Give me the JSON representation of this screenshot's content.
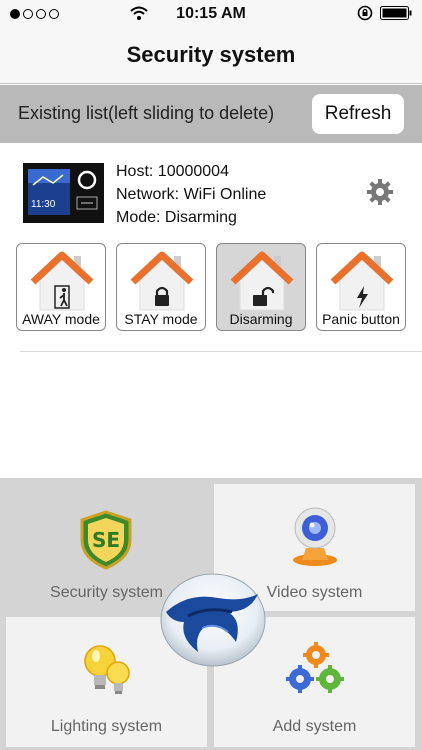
{
  "status_bar": {
    "time": "10:15 AM"
  },
  "nav": {
    "title": "Security system"
  },
  "list_header": {
    "hint": "Existing list(left sliding to delete)",
    "refresh_label": "Refresh"
  },
  "device": {
    "host": "Host: 10000004",
    "network": "Network: WiFi Online",
    "mode": "Mode: Disarming",
    "screen_time": "11:30"
  },
  "modes": [
    {
      "label": "AWAY mode",
      "icon": "person-door-icon"
    },
    {
      "label": "STAY mode",
      "icon": "lock-icon"
    },
    {
      "label": "Disarming",
      "icon": "unlock-icon",
      "active": true
    },
    {
      "label": "Panic button",
      "icon": "lightning-icon"
    }
  ],
  "systems": [
    {
      "label": "Security system",
      "icon": "shield-icon",
      "selected": true
    },
    {
      "label": "Video system",
      "icon": "webcam-icon"
    },
    {
      "label": "Lighting system",
      "icon": "lightbulb-icon"
    },
    {
      "label": "Add system",
      "icon": "gears-icon"
    }
  ],
  "colors": {
    "roof": "#e9712c",
    "house_wall": "#f1f1f1",
    "header_gray": "#b9b9b9",
    "grid_gray": "#d4d4d4"
  }
}
